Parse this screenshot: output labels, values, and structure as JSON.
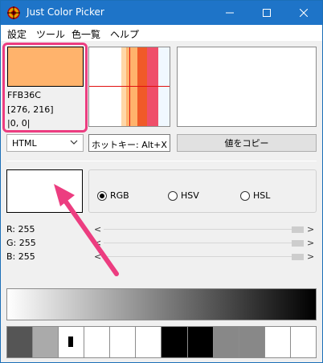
{
  "window": {
    "title": "Just Color Picker"
  },
  "menu": [
    {
      "label": "設定"
    },
    {
      "label": "ツール"
    },
    {
      "label": "色一覧"
    },
    {
      "label": "ヘルプ"
    }
  ],
  "picker": {
    "hex": "FFB36C",
    "coords": "[276, 216]",
    "position": "|0, 0|",
    "swatch_color": "#ffb36c"
  },
  "format": {
    "selected": "HTML"
  },
  "hotkey": {
    "text": "ホットキー: Alt+X"
  },
  "copy_button": {
    "label": "値をコピー"
  },
  "modes": [
    {
      "label": "RGB",
      "selected": true
    },
    {
      "label": "HSV",
      "selected": false
    },
    {
      "label": "HSL",
      "selected": false
    }
  ],
  "channels": [
    {
      "label": "R: 255",
      "level": 1.0
    },
    {
      "label": "G: 255",
      "level": 1.0
    },
    {
      "label": "B: 255",
      "level": 1.0
    }
  ],
  "palette": [
    "#555555",
    "#aaaaaa",
    "#ffffff",
    "#ffffff",
    "#ffffff",
    "#ffffff",
    "#000000",
    "#000000",
    "#888888",
    "#888888",
    "#ffffff",
    "#ffffff"
  ],
  "zoom_bands": [
    "#ffffff",
    "#ffd7a8",
    "#ffb36c",
    "#f05a28",
    "#ef4f6a",
    "#f0f8ff"
  ],
  "colors": {
    "titlebar": "#1e74c8",
    "highlight": "#ec3d80"
  }
}
